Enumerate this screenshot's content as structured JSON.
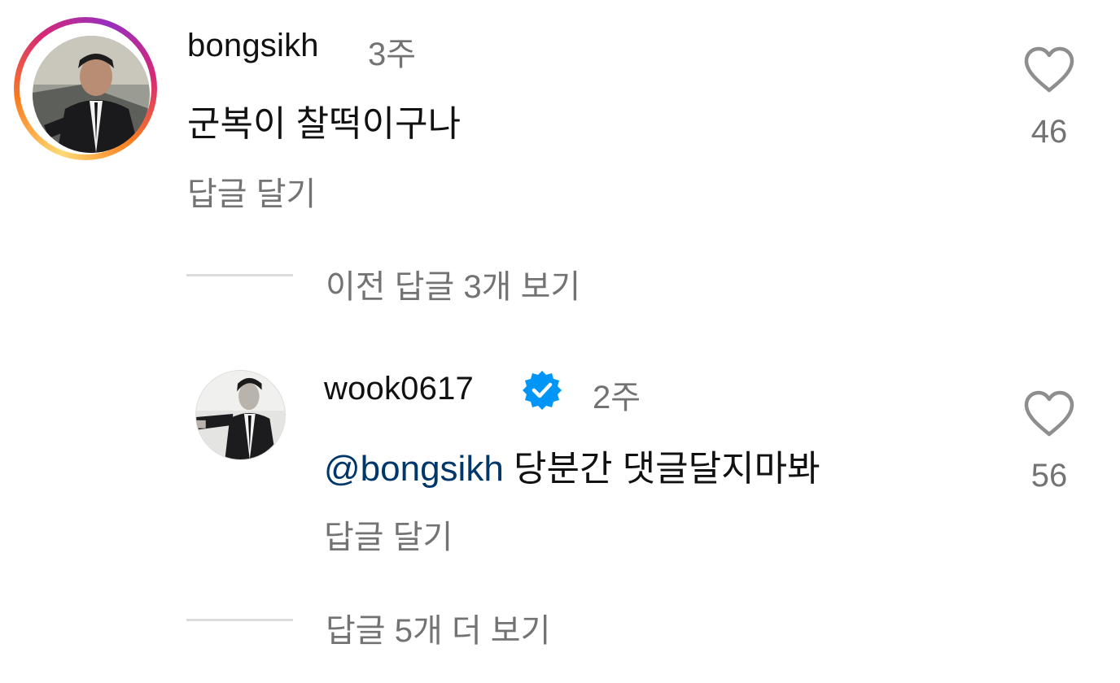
{
  "comments": [
    {
      "username": "bongsikh",
      "time": "3주",
      "text": "군복이 찰떡이구나",
      "reply_label": "답글 달기",
      "likes": "46",
      "has_story_ring": true,
      "verified": false
    }
  ],
  "thread_links": {
    "previous_replies": "이전 답글 3개 보기",
    "more_replies": "답글 5개 더 보기"
  },
  "replies": [
    {
      "username": "wook0617",
      "time": "2주",
      "mention": "@bongsikh",
      "text": "당분간 댓글달지마봐",
      "reply_label": "답글 달기",
      "likes": "56",
      "verified": true
    }
  ],
  "icons": {
    "like": "heart-outline-icon",
    "verified": "verified-badge-icon"
  },
  "colors": {
    "text_primary": "#111111",
    "text_secondary": "#737373",
    "mention": "#00376b",
    "verified": "#0095f6",
    "divider": "#dbdbdb"
  }
}
